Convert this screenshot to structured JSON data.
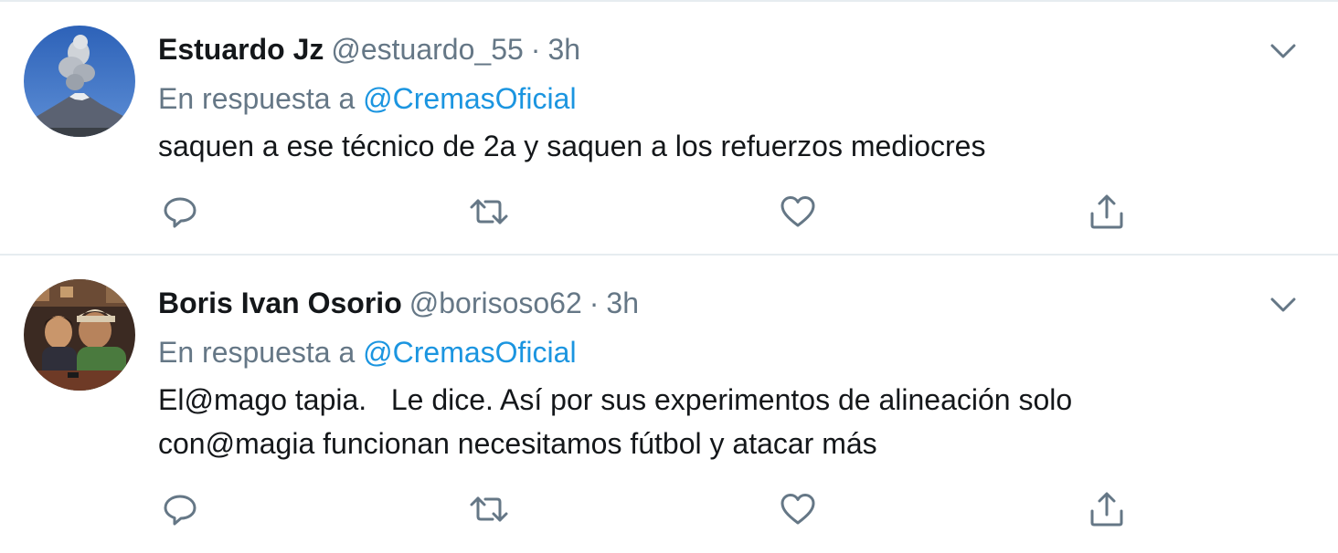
{
  "tweets": [
    {
      "name": "Estuardo Jz",
      "handle": "@estuardo_55",
      "separator": "·",
      "time": "3h",
      "reply_prefix": "En respuesta a",
      "reply_to": "@CremasOficial",
      "text": "saquen a ese técnico de 2a y saquen a los refuerzos mediocres",
      "avatar": "volcano-eruption-photo",
      "actions": [
        "reply-icon",
        "retweet-icon",
        "like-icon",
        "share-icon"
      ]
    },
    {
      "name": "Boris Ivan Osorio",
      "handle": "@borisoso62",
      "separator": "·",
      "time": "3h",
      "reply_prefix": "En respuesta a",
      "reply_to": "@CremasOficial",
      "text": "El@mago tapia.   Le dice. Así por sus experimentos de alineación solo con@magia funcionan necesitamos fútbol y atacar más",
      "avatar": "father-and-son-photo",
      "actions": [
        "reply-icon",
        "retweet-icon",
        "like-icon",
        "share-icon"
      ]
    }
  ],
  "colors": {
    "text": "#14171a",
    "secondary": "#657786",
    "link": "#1b95e0",
    "border": "#e6ecf0"
  }
}
